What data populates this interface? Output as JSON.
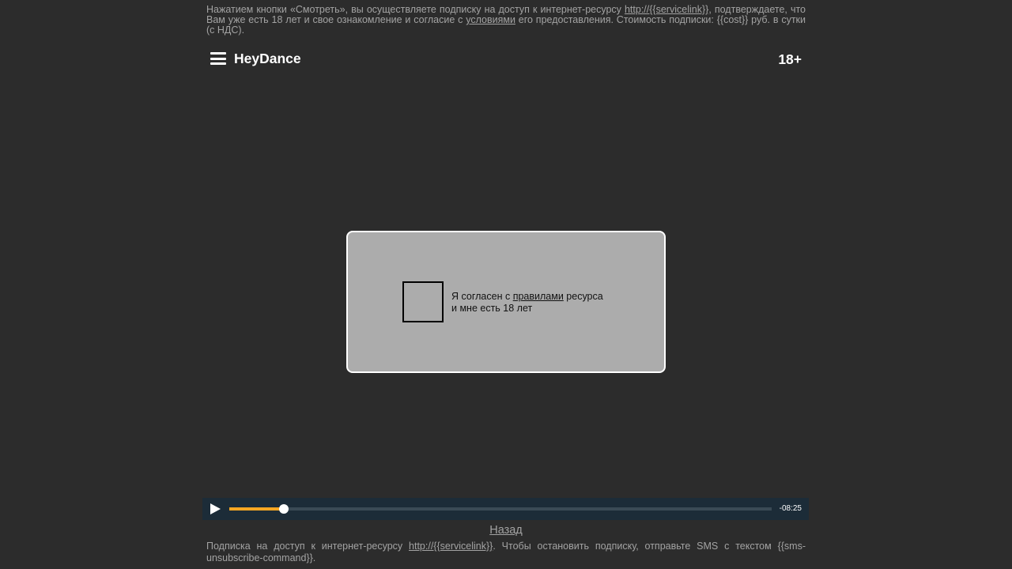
{
  "top_disclaimer": {
    "part1": "Нажатием кнопки «Смотреть», вы осуществляете подписку на доступ к интернет-ресурсу ",
    "link1": "http://{{servicelink}}",
    "part2": ", подтверждаете, что Вам уже есть 18 лет и свое ознакомление и согласие с ",
    "link2": "условиями",
    "part3": " его предоставления. Стоимость подписки: {{cost}} руб. в сутки (с НДС)."
  },
  "header": {
    "brand": "HeyDance",
    "age_badge": "18+",
    "menu_icon": "hamburger-menu-icon"
  },
  "consent": {
    "text_before": "Я согласен с ",
    "rules_link": "правилами",
    "text_after": " ресурса",
    "line2": "и мне есть 18 лет",
    "checked": false
  },
  "player": {
    "play_icon": "play-icon",
    "progress_fraction": 0.1,
    "time_remaining": "-08:25",
    "colors": {
      "progress": "#f5a623",
      "bar_background": "#1c2c38"
    }
  },
  "back_link": "Назад",
  "bottom_disclaimer": {
    "part1": "Подписка на доступ к интернет-ресурсу ",
    "link": "http://{{servicelink}}",
    "part2": ". Чтобы остановить подписку, отправьте SMS с текстом {{sms-unsubscribe-command}}."
  }
}
